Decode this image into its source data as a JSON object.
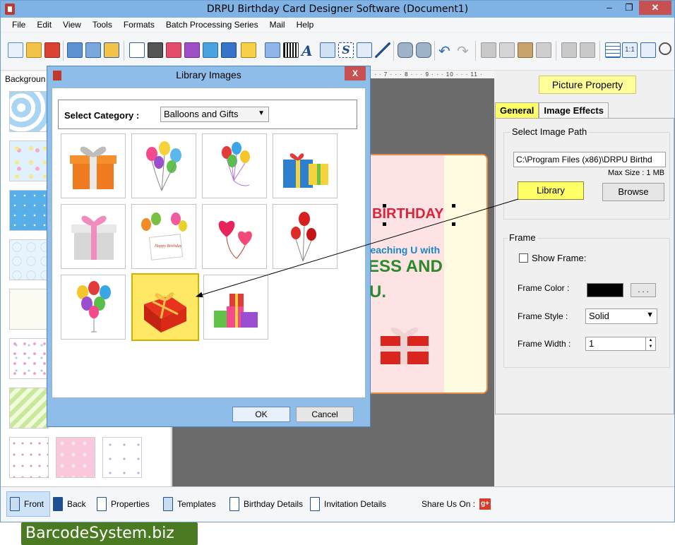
{
  "window": {
    "title": "DRPU Birthday Card Designer Software (Document1)"
  },
  "menu": [
    "File",
    "Edit",
    "View",
    "Tools",
    "Formats",
    "Batch Processing Series",
    "Mail",
    "Help"
  ],
  "left_panel": {
    "label": "Backgroun"
  },
  "card": {
    "line1": "BIRTHDAY",
    "line2": "reaching U with",
    "line3": "ESS AND",
    "line4": "U."
  },
  "ruler": {
    "ticks": "· · 7 · · · 8 · · · 9 · · · 10 · · · 11 ·"
  },
  "dialog": {
    "title": "Library Images",
    "close_label": "X",
    "category_label": "Select Category :",
    "category_value": "Balloons and Gifts",
    "ok_label": "OK",
    "cancel_label": "Cancel",
    "selected_index": 9
  },
  "right_panel": {
    "title": "Picture Property",
    "tabs": [
      "General",
      "Image Effects"
    ],
    "select_image_path_label": "Select Image Path",
    "path_value": "C:\\Program Files (x86)\\DRPU Birthd",
    "max_size": "Max Size : 1 MB",
    "library_label": "Library",
    "browse_label": "Browse",
    "frame_label": "Frame",
    "show_frame_label": "Show Frame:",
    "frame_color_label": "Frame Color :",
    "frame_color_value": "#000000",
    "ellipsis_label": ". . .",
    "frame_style_label": "Frame Style :",
    "frame_style_value": "Solid",
    "frame_width_label": "Frame Width :",
    "frame_width_value": "1"
  },
  "bottom_bar": {
    "items": [
      "Front",
      "Back",
      "Properties",
      "Templates",
      "Birthday Details",
      "Invitation Details"
    ],
    "share_label": "Share Us On :",
    "gplus": "g+"
  },
  "watermark": "BarcodeSystem.biz"
}
